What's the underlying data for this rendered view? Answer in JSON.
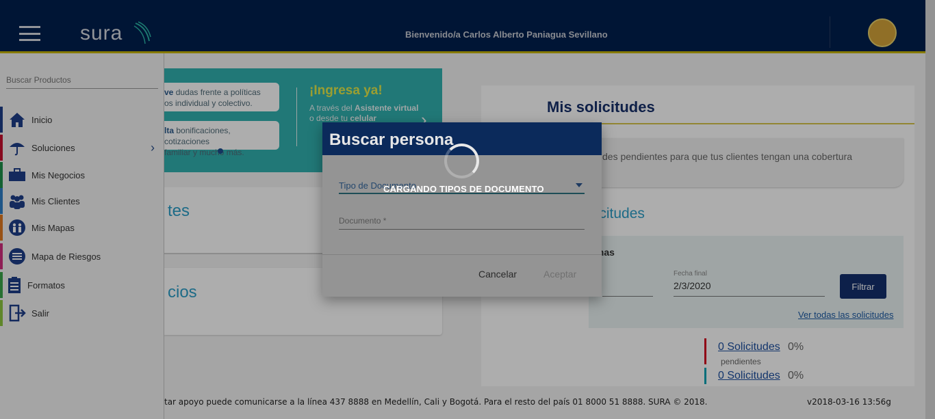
{
  "header": {
    "logo": "sura",
    "welcome": "Bienvenido/a Carlos Alberto Paniagua Sevillano"
  },
  "sidebar": {
    "search_placeholder": "Buscar Productos",
    "items": [
      {
        "label": "Inicio",
        "icon": "home-icon",
        "color": "#1e3f8a"
      },
      {
        "label": "Soluciones",
        "icon": "umbrella-icon",
        "color": "#c8102e"
      },
      {
        "label": "Mis Negocios",
        "icon": "briefcase-icon",
        "color": "#1d8f4a"
      },
      {
        "label": "Mis Clientes",
        "icon": "people-icon",
        "color": "#2f7fc7"
      },
      {
        "label": "Mis Mapas",
        "icon": "map-people-icon",
        "color": "#e07a1f"
      },
      {
        "label": "Mapa de Riesgos",
        "icon": "list-circle-icon",
        "color": "#d22f7e"
      },
      {
        "label": "Formatos",
        "icon": "clipboard-icon",
        "color": "#3aa64b"
      },
      {
        "label": "Salir",
        "icon": "logout-icon",
        "color": "#8dc63f"
      }
    ]
  },
  "banner": {
    "line1_bold": "ve",
    "line1_rest": " dudas frente a políticas",
    "line1b": "os individual y colectivo.",
    "line2_bold": "lta",
    "line2_rest": " bonificaciones, cotizaciones",
    "line2b": "familiar y mucho más.",
    "ingresa": "¡Ingresa ya!",
    "sub_pre": "A través del ",
    "sub_bold": "Asistente virtual",
    "sub_post": "o desde tu ",
    "sub_bold2": "celular"
  },
  "left_cards": {
    "h1": "tes",
    "h2": "cios"
  },
  "right": {
    "title": "Mis solicitudes",
    "notice": "des pendientes para que tus clientes tengan una cobertura",
    "solicitudes_heading": "licitudes",
    "fechas": "chas",
    "fecha_final_label": "Fecha final",
    "fecha_final_value": "2/3/2020",
    "filtrar": "Filtrar",
    "ver_todas": "Ver todas las solicitudes",
    "stat1_link": "0 Solicitudes",
    "stat1_pct": "0%",
    "pendientes": "pendientes",
    "stat2_link": "0 Solicitudes",
    "stat2_pct": "0%"
  },
  "footer": {
    "text": "tar apoyo puede comunicarse a la línea 437 8888 en Medellín, Cali y Bogotá. Para el resto del país 01 8000 51 8888. SURA © 2018.",
    "version": "v2018-03-16 13:56g"
  },
  "dialog": {
    "title": "Buscar persona",
    "tipo_label": "Tipo de Documento",
    "documento_label": "Documento *",
    "cancel": "Cancelar",
    "accept": "Aceptar",
    "loading": "CARGANDO TIPOS DE DOCUMENTO"
  }
}
